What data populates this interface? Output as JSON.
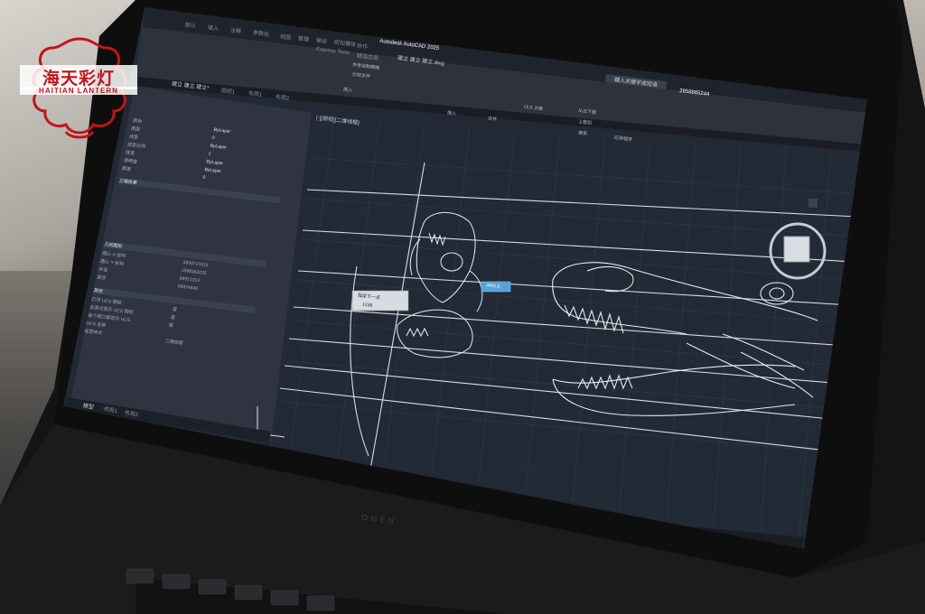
{
  "logo": {
    "title": "海天彩灯",
    "subtitle": "HAITIAN LANTERN"
  },
  "window": {
    "title": "Autodesk AutoCAD 2025",
    "file": "建立 建立 建立.dwg",
    "user": "2658865244",
    "search_placeholder": "键入关键字或短语"
  },
  "ribbon": {
    "tabs": [
      "默认",
      "插入",
      "注释",
      "参数化",
      "视图",
      "管理",
      "输出",
      "附加模块",
      "协作",
      "Express Tools",
      "精选应用"
    ],
    "group_labels": [
      "插入",
      "共享",
      "从 PDF 导入",
      "插入",
      "合并",
      "应用程序"
    ],
    "buttons": [
      "参考绘制精确",
      "比较文件",
      "OLE 对象",
      "从云下载",
      "上载到",
      "搜索"
    ]
  },
  "file_tabs": [
    "建立 建立 建立*",
    "图纸1",
    "布局1",
    "布局2"
  ],
  "viewport_label": "[-][俯视][二维线框]",
  "properties": {
    "rows": [
      {
        "name": "颜色",
        "value": "ByLayer"
      },
      {
        "name": "图层",
        "value": "0"
      },
      {
        "name": "线型",
        "value": "ByLayer"
      },
      {
        "name": "线型比例",
        "value": "1"
      },
      {
        "name": "线宽",
        "value": "ByLayer"
      },
      {
        "name": "透明度",
        "value": "ByLayer"
      },
      {
        "name": "厚度",
        "value": "0"
      }
    ],
    "section_3d": "三维效果",
    "section_geom": "几何图形",
    "geom_rows": [
      {
        "name": "圆心 X 坐标",
        "value": "3930712615"
      },
      {
        "name": "圆心 Y 坐标",
        "value": "1598363025"
      },
      {
        "name": "半径",
        "value": "59921313"
      },
      {
        "name": "直径",
        "value": "59924849"
      }
    ],
    "section_misc": "其他",
    "misc_rows": [
      {
        "name": "打开 UCS 图标",
        "value": "是"
      },
      {
        "name": "在原点显示 UCS 图标",
        "value": "是"
      },
      {
        "name": "每个视口都显示 UCS",
        "value": "是"
      },
      {
        "name": "UCS 名称",
        "value": ""
      },
      {
        "name": "视觉样式",
        "value": "二维线框"
      }
    ]
  },
  "layout_tabs": [
    "模型",
    "布局1",
    "布局2"
  ],
  "drawing": {
    "tooltip_value": "3842.5",
    "dim_input_1": "指定下一点",
    "dim_input_2": "1238"
  },
  "brand": "OMEN"
}
